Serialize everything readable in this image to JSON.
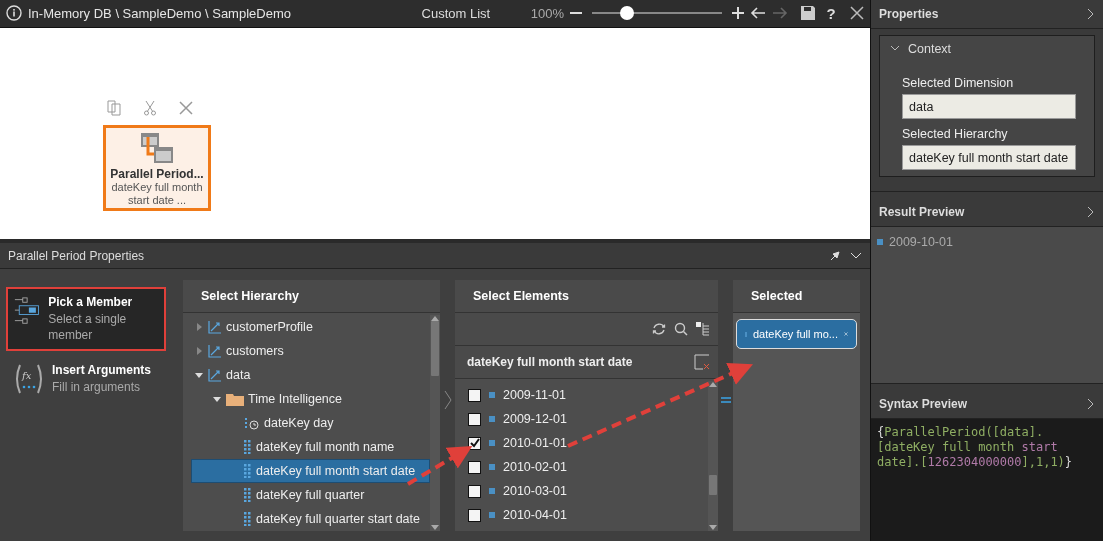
{
  "window": {
    "breadcrumb": "In-Memory DB \\ SampleDemo \\ SampleDemo",
    "title": "Custom List",
    "zoom": {
      "reading": "100%",
      "level": 0.27
    },
    "forward_disabled": true,
    "help": "?"
  },
  "canvas": {
    "node": {
      "title": "Parallel Period...",
      "subtitle": "dateKey full month start date ...",
      "selected": true
    }
  },
  "panel": {
    "title": "Parallel Period Properties",
    "modes": [
      {
        "title": "Pick a Member",
        "subtitle": "Select a single member",
        "kind": "member",
        "selected": true
      },
      {
        "title": "Insert Arguments",
        "subtitle": "Fill in arguments",
        "kind": "function",
        "icon_text": "fx",
        "selected": false
      }
    ],
    "hierarchy": {
      "title": "Select Hierarchy",
      "items": [
        {
          "label": "customerProfile",
          "kind": "dimension",
          "expanded": false,
          "selected": false
        },
        {
          "label": "customers",
          "kind": "dimension",
          "expanded": false,
          "selected": false
        },
        {
          "label": "data",
          "kind": "dimension",
          "expanded": true,
          "selected": false,
          "children": [
            {
              "label": "Time Intelligence",
              "kind": "folder",
              "expanded": true,
              "selected": false,
              "children": [
                {
                  "label": "dateKey day",
                  "kind": "time-level",
                  "selected": false
                },
                {
                  "label": "dateKey full month name",
                  "kind": "level",
                  "selected": false
                },
                {
                  "label": "dateKey full month start date",
                  "kind": "level",
                  "selected": true
                },
                {
                  "label": "dateKey full quarter",
                  "kind": "level",
                  "selected": false
                },
                {
                  "label": "dateKey full quarter start date",
                  "kind": "level",
                  "selected": false
                }
              ]
            }
          ]
        }
      ]
    },
    "elements": {
      "title": "Select Elements",
      "list_title": "dateKey full month start date",
      "items": [
        {
          "label": "2009-11-01",
          "checked": false
        },
        {
          "label": "2009-12-01",
          "checked": false
        },
        {
          "label": "2010-01-01",
          "checked": true
        },
        {
          "label": "2010-02-01",
          "checked": false
        },
        {
          "label": "2010-03-01",
          "checked": false
        },
        {
          "label": "2010-04-01",
          "checked": false
        }
      ]
    },
    "selected": {
      "title": "Selected",
      "chips": [
        "dateKey full mo..."
      ]
    }
  },
  "sidebar": {
    "properties": {
      "title": "Properties",
      "group": "Context",
      "expanded": true,
      "fields": [
        {
          "label": "Selected Dimension",
          "value": "data"
        },
        {
          "label": "Selected Hierarchy",
          "value": "dateKey full month start date"
        }
      ]
    },
    "result_preview": {
      "title": "Result Preview",
      "items": [
        "2009-10-01"
      ]
    },
    "syntax_preview": {
      "title": "Syntax Preview",
      "tokens": [
        {
          "text": "{",
          "kind": "brace"
        },
        {
          "text": "ParallelPeriod([data].",
          "kind": "ident"
        },
        {
          "text": "[dateKey full month ",
          "kind": "ident"
        },
        {
          "text": "start",
          "kind": "literal"
        },
        {
          "text": " date].[",
          "kind": "ident"
        },
        {
          "text": "1262304000000",
          "kind": "literal"
        },
        {
          "text": "],1,1)",
          "kind": "ident"
        },
        {
          "text": "}",
          "kind": "brace"
        }
      ]
    }
  }
}
